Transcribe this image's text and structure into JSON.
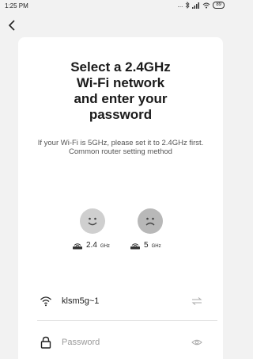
{
  "status_bar": {
    "time": "1:25 PM",
    "dots": "...",
    "battery": "89"
  },
  "header": {
    "back_icon": "chevron-left-icon"
  },
  "card": {
    "title_lines": [
      "Select a 2.4GHz",
      "Wi-Fi network",
      "and enter your",
      "password"
    ],
    "subtitle": "If your Wi-Fi is 5GHz, please set it to 2.4GHz first. Common router setting method",
    "options": [
      {
        "face": "happy-face-icon",
        "num": "2.4",
        "unit": "GHz"
      },
      {
        "face": "sad-face-icon",
        "num": "5",
        "unit": "GHz"
      }
    ],
    "wifi_field": {
      "icon": "wifi-icon",
      "value": "klsm5g~1",
      "action_icon": "switch-network-icon"
    },
    "password_field": {
      "icon": "lock-icon",
      "placeholder": "Password",
      "action_icon": "eye-icon"
    }
  }
}
